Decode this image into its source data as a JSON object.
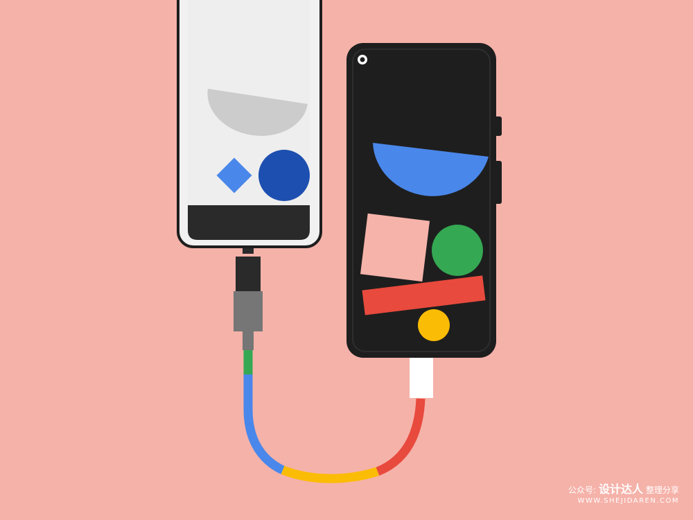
{
  "colors": {
    "background": "#f5b2a9",
    "phone_white_body": "#f1f1f1",
    "phone_dark_body": "#1e1e1e",
    "blue": "#4a87ea",
    "dark_blue": "#1d4fb0",
    "green": "#34a853",
    "red": "#e84a3d",
    "yellow": "#fbbc05",
    "pink": "#f6b3aa",
    "grey": "#cccccc"
  },
  "icons": [
    "phone-light-icon",
    "phone-dark-icon",
    "usb-c-plug-icon",
    "usb-a-plug-icon",
    "multicolor-cable-icon"
  ],
  "watermark": {
    "prefix": "公众号:",
    "brand": "设计达人",
    "suffix": "整理分享",
    "url": "WWW.SHEJIDAREN.COM",
    "color": "#ffffff"
  }
}
